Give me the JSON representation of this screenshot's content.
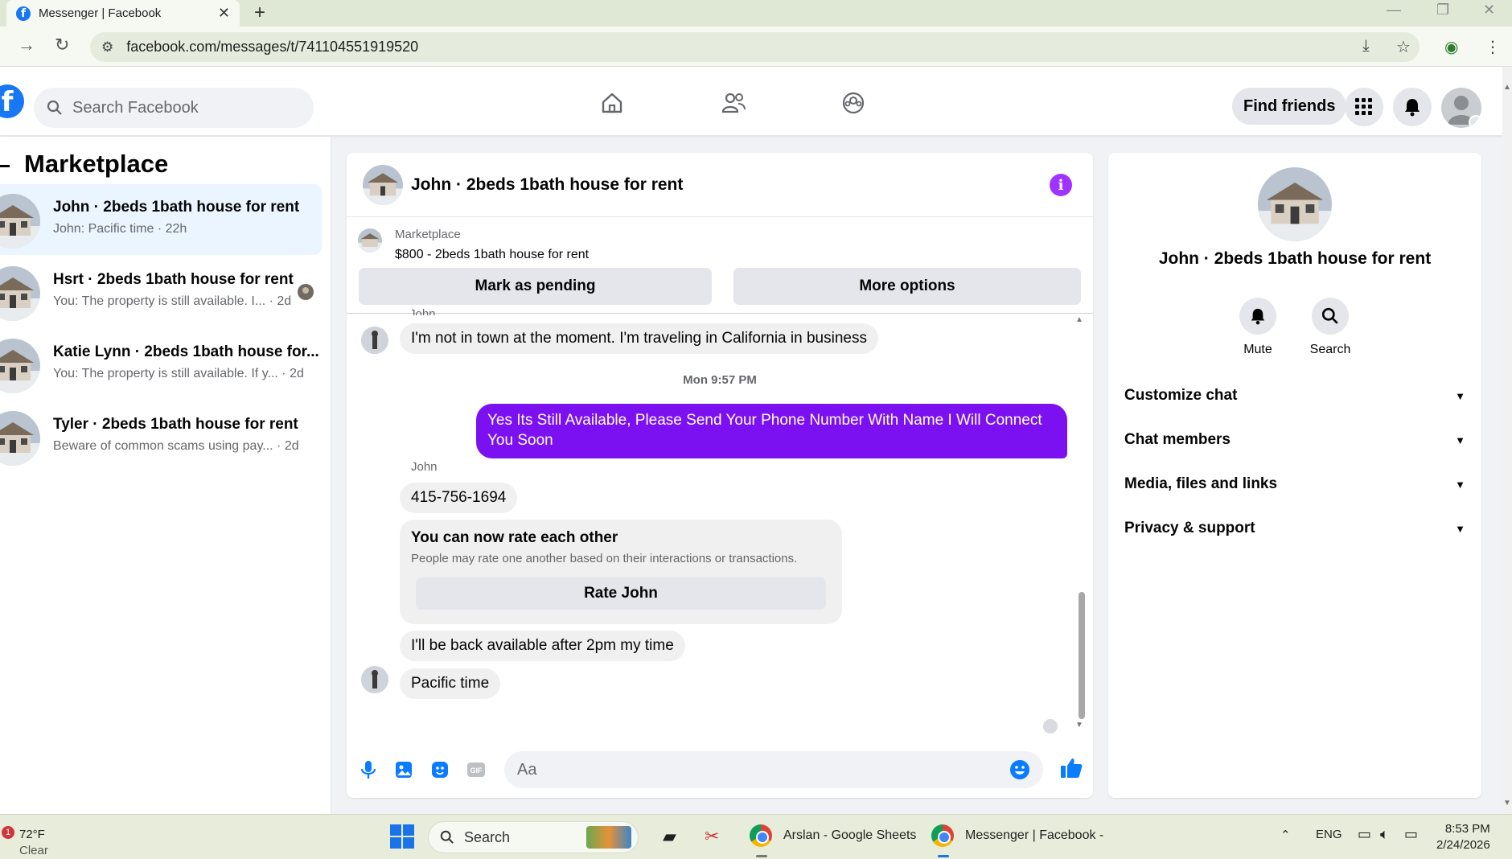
{
  "browser": {
    "tab_title": "Messenger | Facebook",
    "url": "facebook.com/messages/t/741104551919520"
  },
  "fb": {
    "search_placeholder": "Search Facebook",
    "find_friends": "Find friends"
  },
  "sidebar": {
    "title": "Marketplace",
    "conversations": [
      {
        "title": "John · 2beds 1bath house for rent",
        "preview": "John: Pacific time · 22h",
        "active": true
      },
      {
        "title": "Hsrt · 2beds 1bath house for rent",
        "preview": "You: The property is still available. I...  · 2d",
        "active": false
      },
      {
        "title": "Katie Lynn · 2beds 1bath house for...",
        "preview": "You: The property is still available. If y...  · 2d",
        "active": false
      },
      {
        "title": "Tyler · 2beds 1bath house for rent",
        "preview": "Beware of common scams using pay...  · 2d",
        "active": false
      }
    ]
  },
  "chat": {
    "title": "John · 2beds 1bath house for rent",
    "marketplace_label": "Marketplace",
    "listing": "$800 - 2beds 1bath house for rent",
    "mark_pending": "Mark as pending",
    "more_options": "More options",
    "partial_sender": "John",
    "messages": {
      "m1": "I'm not in town at the moment. I'm traveling in California in business",
      "time": "Mon 9:57 PM",
      "m2": "Yes Its Still Available, Please Send Your Phone Number With Name I Will Connect You Soon",
      "sender": "John",
      "m3": "415-756-1694",
      "m4": "I'll be back available after 2pm my time",
      "m5": "Pacific time"
    },
    "rate": {
      "title": "You can now rate each other",
      "desc": "People may rate one another based on their interactions or transactions.",
      "button": "Rate John"
    },
    "composer_placeholder": "Aa"
  },
  "details": {
    "name": "John · 2beds 1bath house for rent",
    "mute": "Mute",
    "search": "Search",
    "rows": [
      "Customize chat",
      "Chat members",
      "Media, files and links",
      "Privacy & support"
    ]
  },
  "taskbar": {
    "temp": "72°F",
    "condition": "Clear",
    "badge": "1",
    "search": "Search",
    "app1": "Arslan - Google Sheets",
    "app2": "Messenger | Facebook -",
    "lang": "ENG",
    "time": "8:53 PM",
    "date": "2/24/2026"
  },
  "colors": {
    "fb_blue": "#1877f2",
    "my_bubble": "#7b10f0",
    "info_purple": "#a033ff"
  }
}
